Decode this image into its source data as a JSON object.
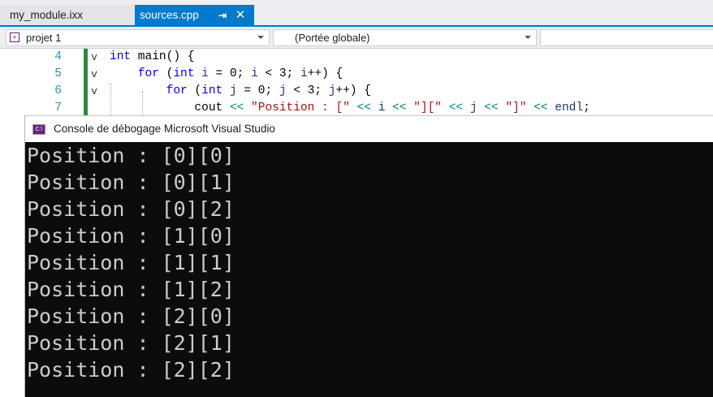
{
  "tabs": [
    {
      "label": "my_module.ixx",
      "active": false
    },
    {
      "label": "sources.cpp",
      "active": true,
      "pin_icon": "pin-icon",
      "close_icon": "close-icon"
    }
  ],
  "navbar": {
    "project": "projet 1",
    "scope": "(Portée globale)",
    "member": ""
  },
  "editor": {
    "lines": [
      {
        "number": "4",
        "fold": "v"
      },
      {
        "number": "5",
        "fold": "v"
      },
      {
        "number": "6",
        "fold": "v"
      },
      {
        "number": "7",
        "fold": ""
      }
    ]
  },
  "console": {
    "title": "Console de débogage Microsoft Visual Studio",
    "icon_text": "C:\\",
    "lines": [
      "Position : [0][0]",
      "Position : [0][1]",
      "Position : [0][2]",
      "Position : [1][0]",
      "Position : [1][1]",
      "Position : [1][2]",
      "Position : [2][0]",
      "Position : [2][1]",
      "Position : [2][2]"
    ]
  },
  "colors": {
    "accent": "#007acc",
    "console_bg": "#0c0c0c",
    "console_fg": "#cccccc",
    "change_bar": "#2a8b3c"
  }
}
